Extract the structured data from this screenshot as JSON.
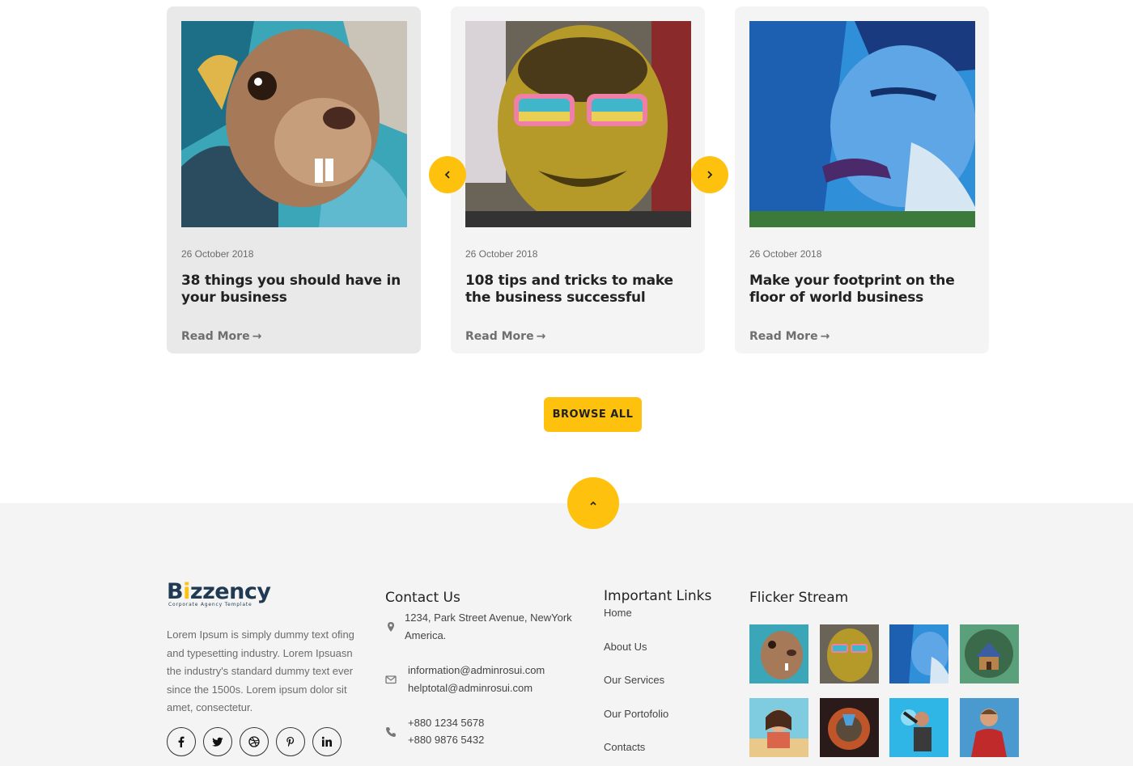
{
  "posts": [
    {
      "date": "26 October 2018",
      "title": "38 things you should have in your business",
      "read_more": "Read More"
    },
    {
      "date": "26 October 2018",
      "title": "108 tips and tricks to make the business successful",
      "read_more": "Read More"
    },
    {
      "date": "26 October 2018",
      "title": "Make your footprint on the floor of world business",
      "read_more": "Read More"
    }
  ],
  "carousel": {
    "prev_icon": "chevron-left-icon",
    "next_icon": "chevron-right-icon"
  },
  "browse_all": "BROWSE ALL",
  "footer": {
    "logo": {
      "brand_pre": "B",
      "brand_i": "i",
      "brand_post": "zzency",
      "tagline": "Corporate Agency Template"
    },
    "about": "Lorem Ipsum is simply dummy text ofing and typesetting industry. Lorem Ipsuasn the industry's standard dummy text ever since the 1500s. Lorem ipsum dolor sit amet, consectetur.",
    "social": [
      "facebook-icon",
      "twitter-icon",
      "dribbble-icon",
      "pinterest-icon",
      "linkedin-icon"
    ],
    "contact": {
      "title": "Contact Us",
      "address": "1234, Park Street Avenue, NewYork America.",
      "email1": "information@adminrosui.com",
      "email2": "helptotal@adminrosui.com",
      "phone1": "+880 1234 5678",
      "phone2": "+880 9876 5432"
    },
    "links": {
      "title": "Important Links",
      "items": [
        "Home",
        "About Us",
        "Our Services",
        "Our Portofolio",
        "Contacts"
      ]
    },
    "flickr": {
      "title": "Flicker Stream"
    }
  },
  "colors": {
    "accent": "#fdc10e",
    "footer_bg": "#f4f4f4",
    "card_bg": "#f4f4f4",
    "brand_navy": "#1f3a52"
  }
}
